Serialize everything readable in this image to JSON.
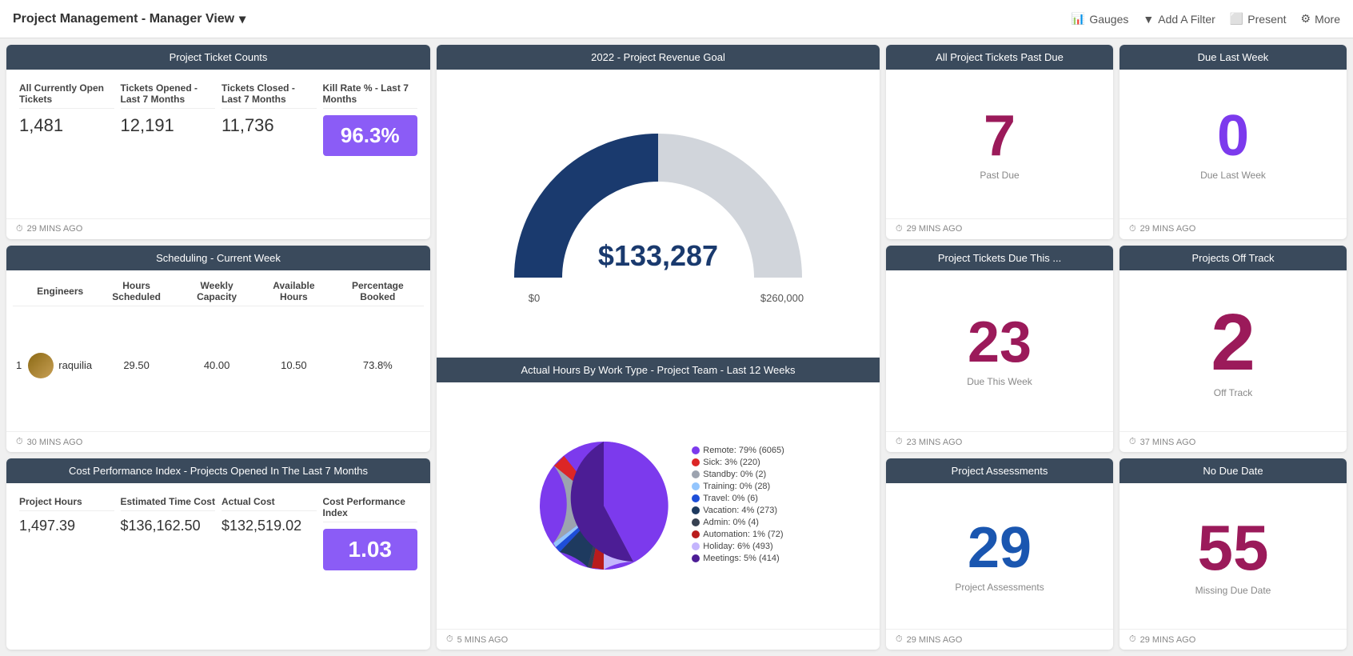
{
  "header": {
    "title": "Project Management - Manager View",
    "actions": {
      "gauges": "Gauges",
      "filter": "Add A Filter",
      "present": "Present",
      "more": "More"
    }
  },
  "ticketCounts": {
    "title": "Project Ticket Counts",
    "columns": [
      {
        "header": "All Currently Open Tickets",
        "value": "1,481",
        "highlight": false
      },
      {
        "header": "Tickets Opened - Last 7 Months",
        "value": "12,191",
        "highlight": false
      },
      {
        "header": "Tickets Closed - Last 7 Months",
        "value": "11,736",
        "highlight": false
      },
      {
        "header": "Kill Rate % - Last 7 Months",
        "value": "96.3%",
        "highlight": true
      }
    ],
    "timestamp": "29 MINS AGO"
  },
  "scheduling": {
    "title": "Scheduling - Current Week",
    "columns": [
      "",
      "Engineers",
      "Hours Scheduled",
      "Weekly Capacity",
      "Available Hours",
      "Percentage Booked"
    ],
    "rows": [
      {
        "num": "1",
        "name": "raquilia",
        "hoursScheduled": "29.50",
        "weeklyCapacity": "40.00",
        "availableHours": "10.50",
        "percentageBooked": "73.8%"
      }
    ],
    "timestamp": "30 MINS AGO"
  },
  "cpi": {
    "title": "Cost Performance Index - Projects Opened In The Last 7 Months",
    "columns": [
      {
        "header": "Project Hours",
        "value": "1,497.39",
        "highlight": false
      },
      {
        "header": "Estimated Time Cost",
        "value": "$136,162.50",
        "highlight": false
      },
      {
        "header": "Actual Cost",
        "value": "$132,519.02",
        "highlight": false
      },
      {
        "header": "Cost Performance Index",
        "value": "1.03",
        "highlight": true
      }
    ],
    "timestamp": "29 MINS AGO"
  },
  "revenueGoal": {
    "title": "2022 - Project Revenue Goal",
    "value": "$133,287",
    "min": "$0",
    "max": "$260,000",
    "percentage": 51.3,
    "timestamp": "5 MINS AGO"
  },
  "hoursChart": {
    "title": "Actual Hours By Work Type - Project Team - Last 12 Weeks",
    "segments": [
      {
        "label": "Remote: 79% (6065)",
        "color": "#7c3aed",
        "percentage": 79
      },
      {
        "label": "Sick: 3% (220)",
        "color": "#dc2626",
        "percentage": 3
      },
      {
        "label": "Standby: 0% (2)",
        "color": "#6b7280",
        "percentage": 0.1
      },
      {
        "label": "Training: 0% (28)",
        "color": "#93c5fd",
        "percentage": 0.5
      },
      {
        "label": "Travel: 0% (6)",
        "color": "#1d4ed8",
        "percentage": 0.1
      },
      {
        "label": "Vacation: 4% (273)",
        "color": "#1e3a5f",
        "percentage": 4
      },
      {
        "label": "Admin: 0% (4)",
        "color": "#374151",
        "percentage": 0.1
      },
      {
        "label": "Automation: 1% (72)",
        "color": "#b91c1c",
        "percentage": 1
      },
      {
        "label": "Holiday: 6% (493)",
        "color": "#c4b5fd",
        "percentage": 6
      },
      {
        "label": "Meetings: 5% (414)",
        "color": "#4c1d95",
        "percentage": 5
      }
    ]
  },
  "allTicketsPastDue": {
    "title": "All Project Tickets Past Due",
    "value": "7",
    "label": "Past Due",
    "timestamp": "29 MINS AGO"
  },
  "dueLastWeek": {
    "title": "Due Last Week",
    "value": "0",
    "label": "Due Last Week",
    "timestamp": "29 MINS AGO"
  },
  "ticketsDueThis": {
    "title": "Project Tickets Due This ...",
    "value": "23",
    "label": "Due This Week",
    "timestamp": "23 MINS AGO"
  },
  "offTrack": {
    "title": "Projects Off Track",
    "value": "2",
    "label": "Off Track",
    "timestamp": "37 MINS AGO"
  },
  "projectAssessments": {
    "title": "Project Assessments",
    "value": "29",
    "label": "Project Assessments",
    "timestamp": "29 MINS AGO"
  },
  "noDueDate": {
    "title": "No Due Date",
    "value": "55",
    "label": "Missing Due Date",
    "timestamp": "29 MINS AGO"
  }
}
